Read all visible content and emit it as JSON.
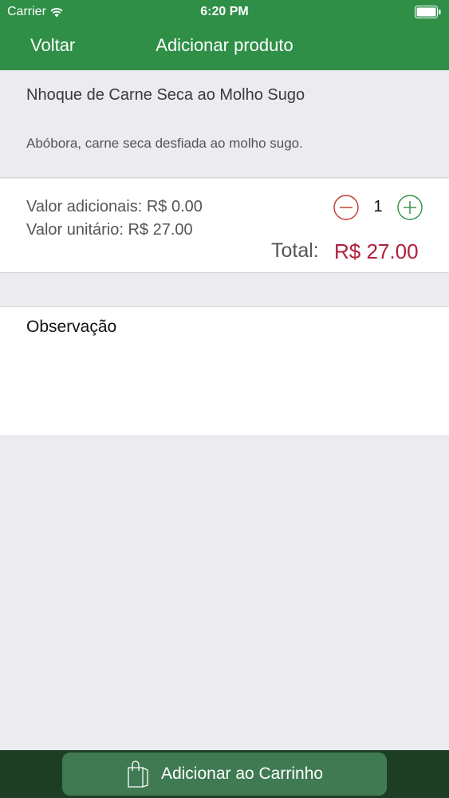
{
  "status_bar": {
    "carrier": "Carrier",
    "time": "6:20 PM"
  },
  "nav": {
    "back_label": "Voltar",
    "title": "Adicionar produto"
  },
  "product": {
    "name": "Nhoque de Carne Seca ao Molho Sugo",
    "description": "Abóbora, carne seca desfiada ao molho sugo."
  },
  "pricing": {
    "additional": "Valor adicionais: R$ 0.00",
    "unit": "Valor unitário: R$ 27.00",
    "quantity": "1",
    "total_label": "Total:",
    "total_value": "R$ 27.00"
  },
  "observation": {
    "label": "Observação"
  },
  "footer": {
    "cart_button_label": "Adicionar ao Carrinho"
  },
  "colors": {
    "header_green": "#2f8f47",
    "total_red": "#b11e3c",
    "minus_red": "#c0392b",
    "plus_green": "#2f8f47",
    "footer_dark_green": "#1d3e25",
    "cart_button_green": "#3f7a52"
  },
  "icons": {
    "wifi": "wifi-icon",
    "battery": "battery-icon",
    "minus": "minus-circle-icon",
    "plus": "plus-circle-icon",
    "bag": "shopping-bag-icon"
  }
}
